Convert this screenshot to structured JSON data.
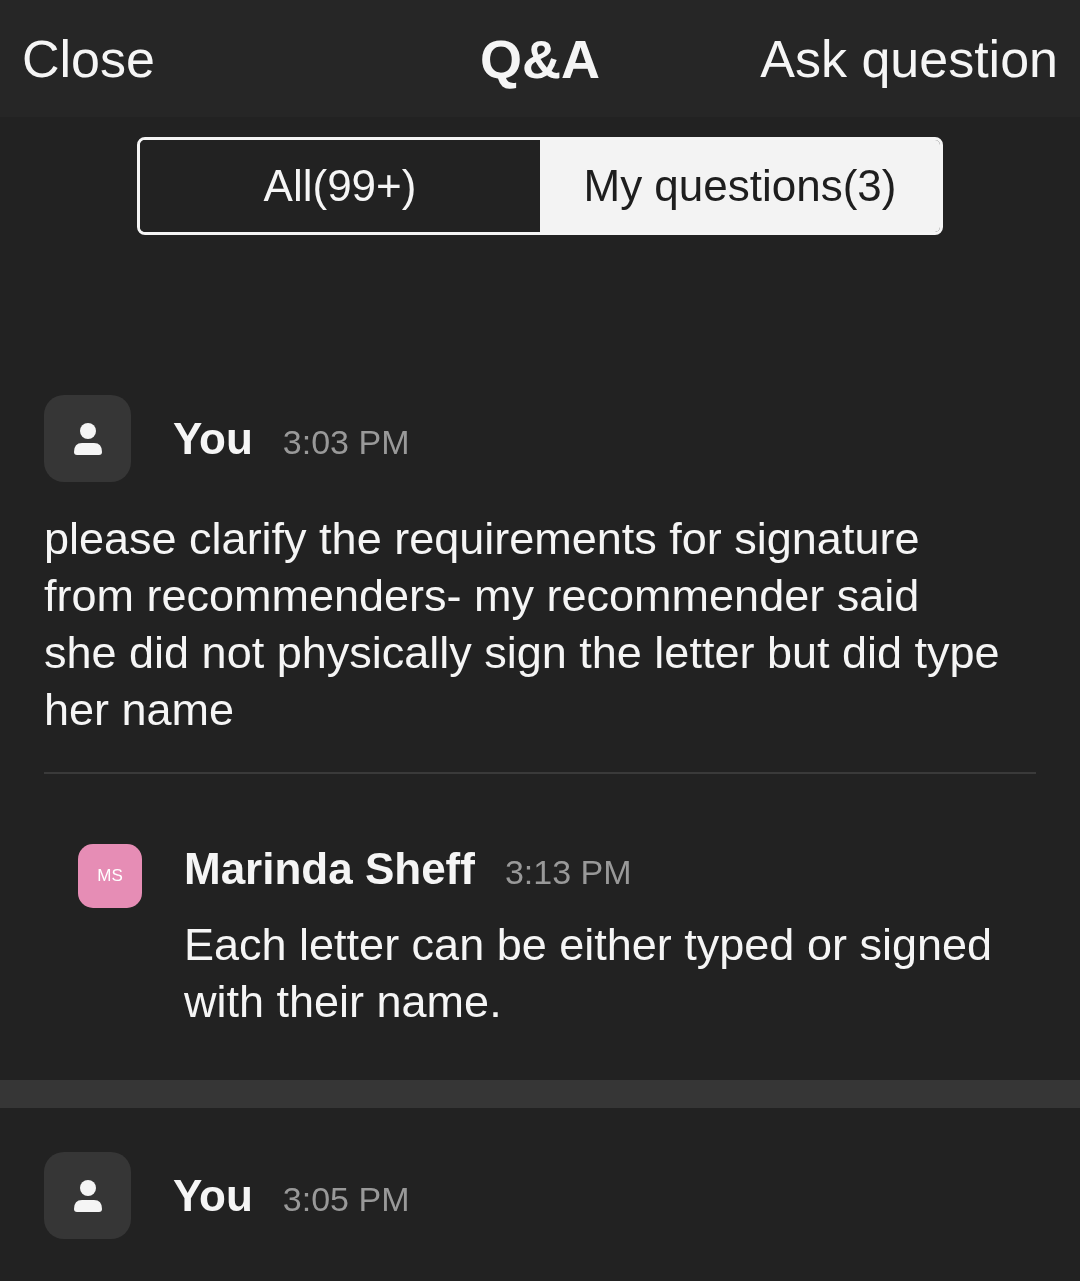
{
  "header": {
    "close": "Close",
    "title": "Q&A",
    "action": "Ask question"
  },
  "tabs": [
    {
      "label": "All(99+)",
      "selected": false
    },
    {
      "label": "My questions(3)",
      "selected": true
    }
  ],
  "questions": [
    {
      "author": "You",
      "time": "3:03 PM",
      "text": "please clarify the requirements for signature from recommenders- my recommender said she did not physically sign the letter but did type her name",
      "replies": [
        {
          "initials": "MS",
          "color": "#e68db5",
          "author": "Marinda Sheff",
          "time": "3:13 PM",
          "text": "Each letter can be either typed or signed with their name."
        }
      ]
    },
    {
      "author": "You",
      "time": "3:05 PM"
    }
  ]
}
